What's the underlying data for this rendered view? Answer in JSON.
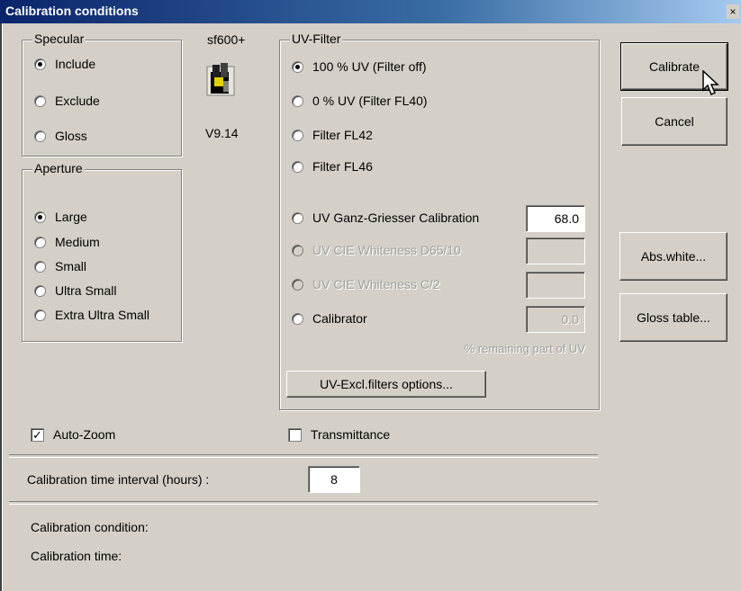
{
  "window": {
    "title": "Calibration conditions",
    "close_glyph": "×"
  },
  "specular": {
    "legend": "Specular",
    "options": [
      "Include",
      "Exclude",
      "Gloss"
    ],
    "selected": 0
  },
  "device": {
    "name": "sf600+",
    "version": "V9.14",
    "icon": "spectrophotometer-icon"
  },
  "aperture": {
    "legend": "Aperture",
    "options": [
      "Large",
      "Medium",
      "Small",
      "Ultra Small",
      "Extra Ultra Small"
    ],
    "selected": 0
  },
  "uv_filter": {
    "legend": "UV-Filter",
    "options": [
      "100 % UV (Filter off)",
      "0 % UV (Filter FL40)",
      "Filter FL42",
      "Filter FL46",
      "UV Ganz-Griesser Calibration",
      "UV CIE Whiteness D65/10",
      "UV CIE Whiteness C/2",
      "Calibrator"
    ],
    "selected": 0,
    "ganz_griesser_value": "68.0",
    "calibrator_value": "0.0",
    "remaining_note": "% remaining part of UV",
    "excl_filters_button": "UV-Excl.filters options..."
  },
  "buttons": {
    "calibrate": "Calibrate",
    "cancel": "Cancel",
    "abs_white": "Abs.white...",
    "gloss_table": "Gloss table..."
  },
  "options": {
    "auto_zoom_label": "Auto-Zoom",
    "auto_zoom_checked": true,
    "transmittance_label": "Transmittance",
    "transmittance_checked": false,
    "check_glyph": "✓"
  },
  "interval": {
    "label": "Calibration time interval (hours) :",
    "value": "8"
  },
  "status": {
    "condition_label": "Calibration condition:",
    "time_label": "Calibration time:"
  }
}
